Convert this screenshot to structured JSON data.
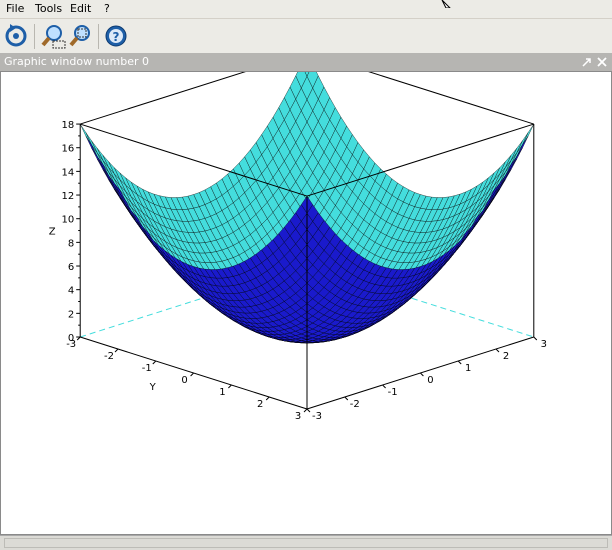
{
  "menu": {
    "file": "File",
    "tools": "Tools",
    "edit": "Edit",
    "help": "?"
  },
  "toolbar": {
    "icons": [
      "rotate-icon",
      "zoom-in-icon",
      "zoom-out-icon",
      "help-icon"
    ]
  },
  "window": {
    "title": "Graphic window number 0"
  },
  "chart_data": {
    "type": "surface",
    "function": "z = x^2 + y^2",
    "x_range": [
      -3,
      3
    ],
    "y_range": [
      -3,
      3
    ],
    "zlim": [
      0,
      18
    ],
    "axis_labels": {
      "y": "Y",
      "z": "Z"
    },
    "z_ticks": [
      0,
      2,
      4,
      6,
      8,
      10,
      12,
      14,
      16,
      18
    ],
    "y_ticks": [
      -3,
      -2,
      -1,
      0,
      1,
      2,
      3
    ],
    "x_ticks": [
      -3,
      -2,
      -1,
      0,
      1,
      2,
      3
    ],
    "colors": {
      "top": "#1a1acc",
      "bottom": "#44dddd",
      "mesh": "#000000",
      "shadow": "#44dddd"
    }
  }
}
